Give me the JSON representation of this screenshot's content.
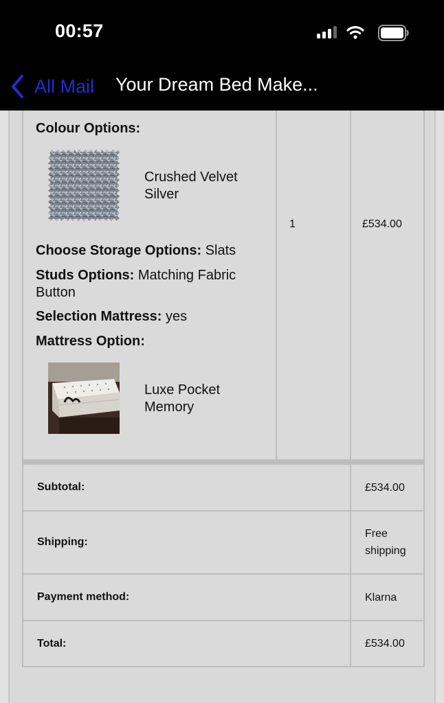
{
  "status_bar": {
    "time": "00:57"
  },
  "nav": {
    "back_label": "All Mail",
    "title": "Your Dream Bed Make..."
  },
  "item": {
    "colour_options_label": "Colour Options:",
    "colour_swatch_name": "Crushed Velvet Silver",
    "storage_label": "Choose Storage Options:",
    "storage_value": "Slats",
    "studs_label": "Studs Options:",
    "studs_value": "Matching Fabric Button",
    "mattress_selection_label": "Selection Mattress:",
    "mattress_selection_value": "yes",
    "mattress_option_label": "Mattress Option:",
    "mattress_name": "Luxe Pocket Memory",
    "quantity": "1",
    "price": "£534.00"
  },
  "totals": [
    {
      "label": "Subtotal:",
      "value": "£534.00"
    },
    {
      "label": "Shipping:",
      "value": "Free shipping"
    },
    {
      "label": "Payment method:",
      "value": "Klarna"
    },
    {
      "label": "Total:",
      "value": "£534.00"
    }
  ],
  "colors": {
    "nav_bg": "#000000",
    "link_blue": "#1f2fd0",
    "table_border": "#bdbdbd",
    "cell_bg": "#dadada"
  }
}
